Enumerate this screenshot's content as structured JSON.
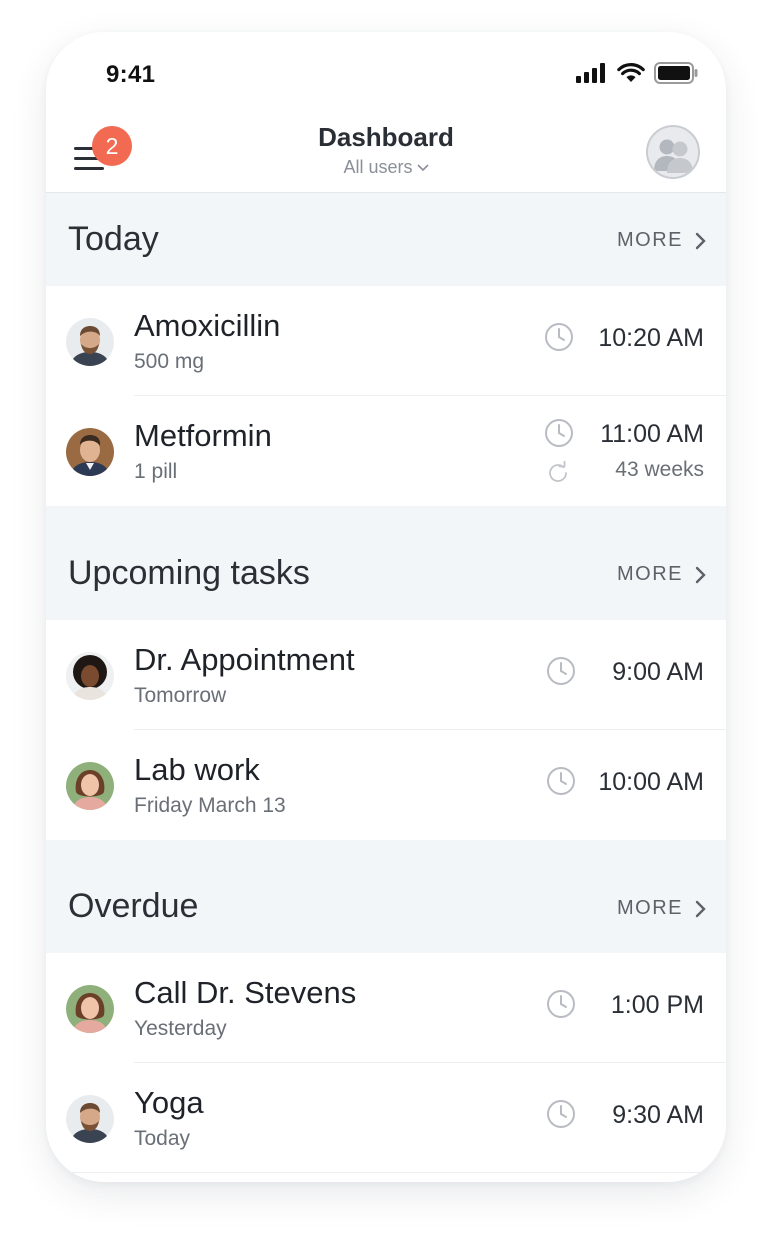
{
  "status_bar": {
    "time": "9:41"
  },
  "nav": {
    "title": "Dashboard",
    "subtitle": "All users",
    "badge_count": "2"
  },
  "sections": [
    {
      "title": "Today",
      "more_label": "MORE",
      "items": [
        {
          "title": "Amoxicillin",
          "subtitle": "500 mg",
          "time": "10:20 AM"
        },
        {
          "title": "Metformin",
          "subtitle": "1 pill",
          "time": "11:00 AM",
          "repeat": "43 weeks"
        }
      ]
    },
    {
      "title": "Upcoming tasks",
      "more_label": "MORE",
      "items": [
        {
          "title": "Dr. Appointment",
          "subtitle": "Tomorrow",
          "time": "9:00 AM"
        },
        {
          "title": "Lab work",
          "subtitle": "Friday March 13",
          "time": "10:00 AM"
        }
      ]
    },
    {
      "title": "Overdue",
      "more_label": "MORE",
      "items": [
        {
          "title": "Call Dr. Stevens",
          "subtitle": "Yesterday",
          "time": "1:00 PM"
        },
        {
          "title": "Yoga",
          "subtitle": "Today",
          "time": "9:30 AM"
        }
      ]
    }
  ],
  "colors": {
    "badge": "#f26a52",
    "section_bg": "#f3f6f9",
    "text_primary": "#1f2329",
    "text_secondary": "#6a6f77",
    "icon_gray": "#b8bcc2"
  },
  "icons": {
    "menu": "hamburger-menu-icon",
    "users": "users-group-icon",
    "clock": "clock-icon",
    "repeat": "repeat-icon",
    "chevron": "chevron-right-icon"
  }
}
